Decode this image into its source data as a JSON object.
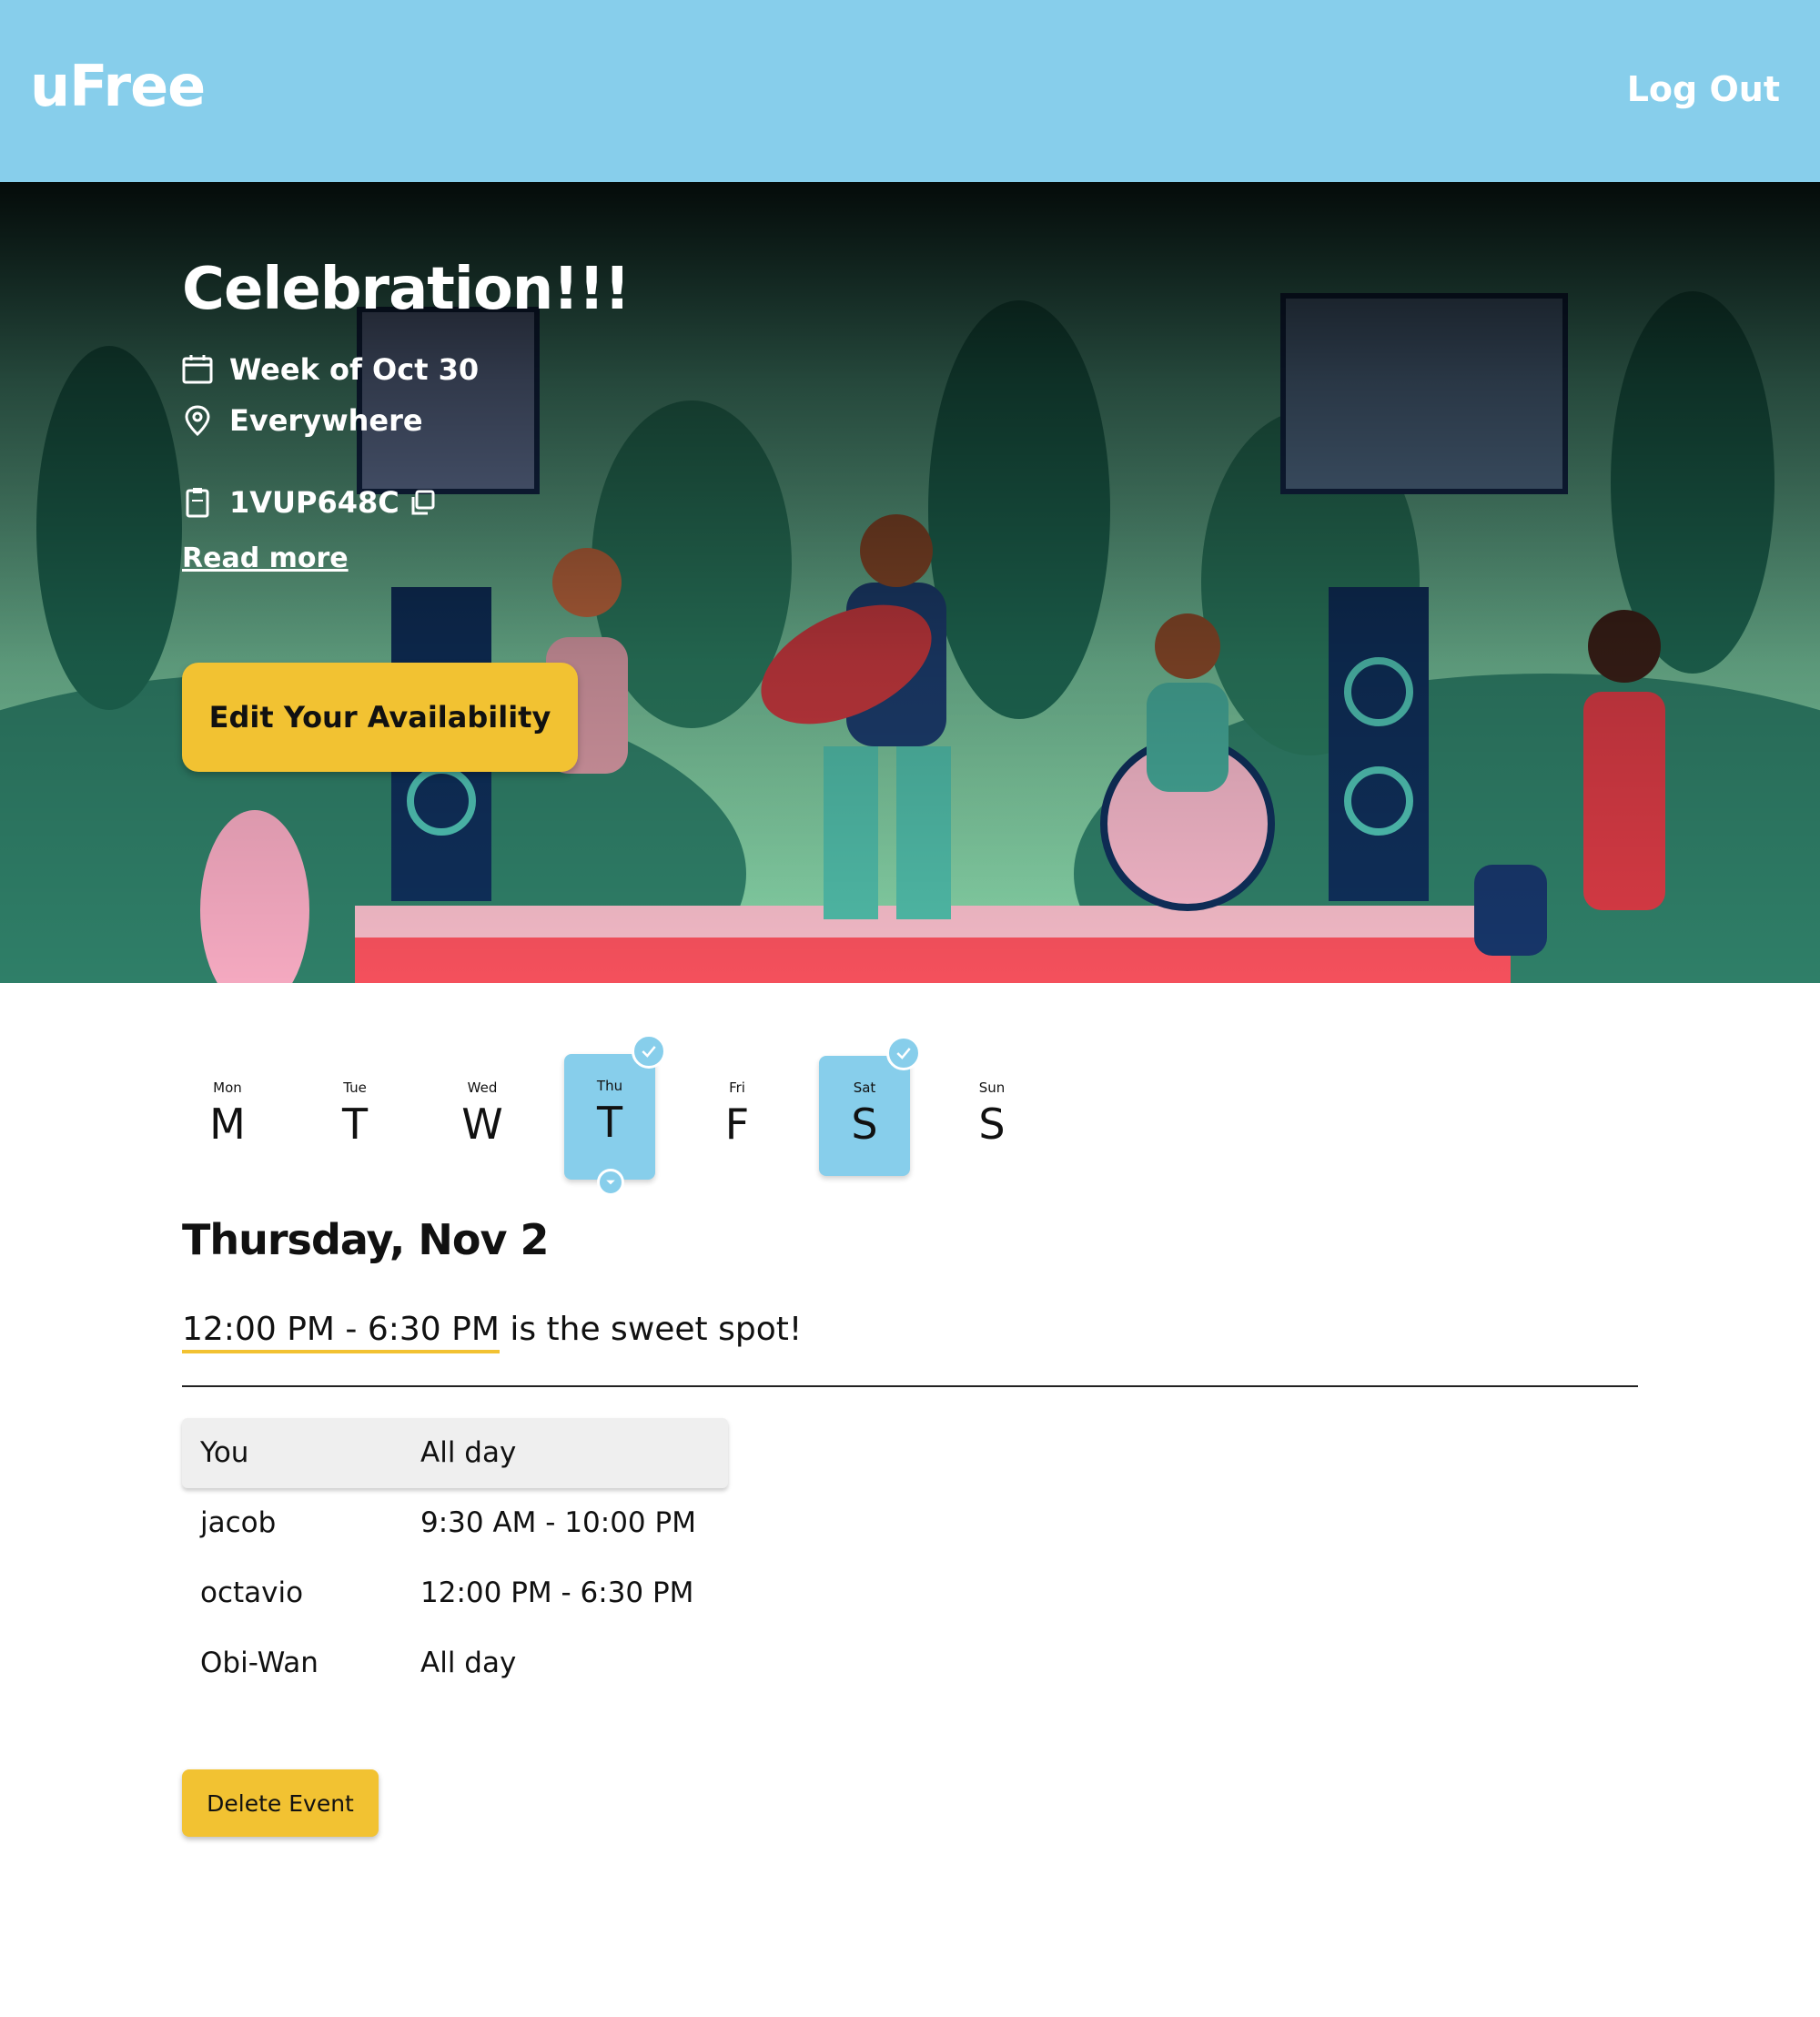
{
  "header": {
    "logo": "uFree",
    "logout_label": "Log Out"
  },
  "event": {
    "title": "Celebration!!!",
    "week": "Week of Oct 30",
    "location": "Everywhere",
    "code": "1VUP648C",
    "read_more": "Read more",
    "edit_button": "Edit Your Availability"
  },
  "days": [
    {
      "short": "Mon",
      "letter": "M",
      "available": false,
      "selected": false
    },
    {
      "short": "Tue",
      "letter": "T",
      "available": false,
      "selected": false
    },
    {
      "short": "Wed",
      "letter": "W",
      "available": false,
      "selected": false
    },
    {
      "short": "Thu",
      "letter": "T",
      "available": true,
      "selected": true
    },
    {
      "short": "Fri",
      "letter": "F",
      "available": false,
      "selected": false
    },
    {
      "short": "Sat",
      "letter": "S",
      "available": true,
      "selected": false
    },
    {
      "short": "Sun",
      "letter": "S",
      "available": false,
      "selected": false
    }
  ],
  "selected_day": {
    "heading": "Thursday, Nov 2",
    "sweet_spot_range": "12:00 PM - 6:30 PM",
    "sweet_spot_suffix": " is the sweet spot!"
  },
  "availability": [
    {
      "name": "You",
      "time": "All day"
    },
    {
      "name": "jacob",
      "time": "9:30 AM - 10:00 PM"
    },
    {
      "name": "octavio",
      "time": "12:00 PM - 6:30 PM"
    },
    {
      "name": "Obi-Wan",
      "time": "All day"
    }
  ],
  "delete_button": "Delete Event",
  "colors": {
    "header": "#87ceeb",
    "accent": "#f2c232",
    "available_day": "#87ceeb"
  }
}
